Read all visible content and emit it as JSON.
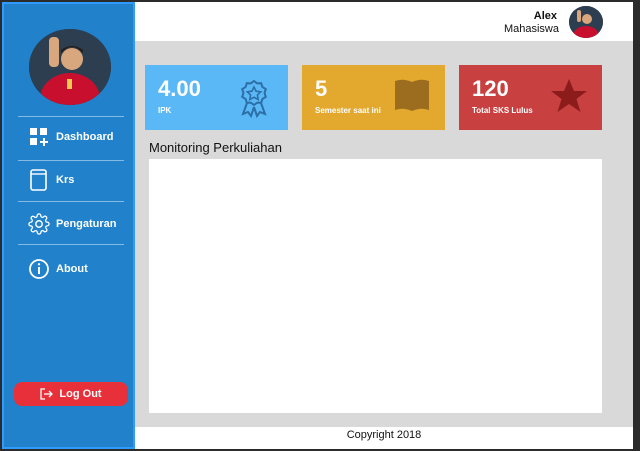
{
  "header": {
    "user_name": "Alex",
    "user_role": "Mahasiswa"
  },
  "sidebar": {
    "items": [
      {
        "label": "Dashboard",
        "icon": "dashboard-icon"
      },
      {
        "label": "Krs",
        "icon": "book-icon"
      },
      {
        "label": "Pengaturan",
        "icon": "gear-icon"
      },
      {
        "label": "About",
        "icon": "info-icon"
      }
    ],
    "logout_label": "Log Out"
  },
  "cards": [
    {
      "value": "4.00",
      "label": "IPK",
      "color": "#5bb8f6",
      "icon": "award-icon"
    },
    {
      "value": "5",
      "label": "Semester saat ini",
      "color": "#e3a82e",
      "icon": "book-icon"
    },
    {
      "value": "120",
      "label": "Total SKS Lulus",
      "color": "#c94040",
      "icon": "star-icon"
    }
  ],
  "main": {
    "section_title": "Monitoring Perkuliahan"
  },
  "footer": {
    "text": "Copyright 2018"
  },
  "colors": {
    "sidebar": "#2181cb",
    "logout": "#e8303a"
  }
}
